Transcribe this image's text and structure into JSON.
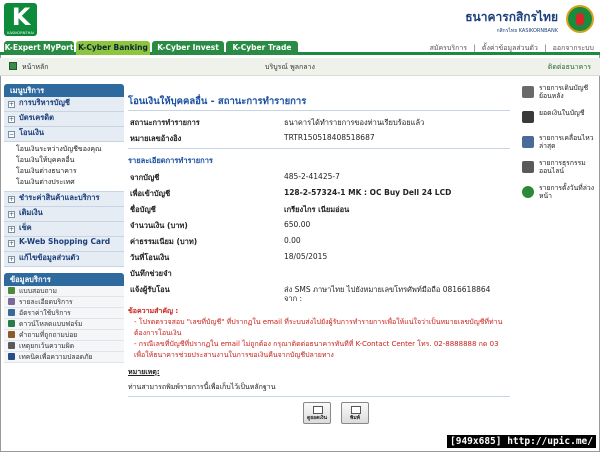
{
  "header": {
    "logo_letter": "K",
    "logo_text": "KASIKORNTHAI",
    "bank_name_th": "ธนาคารกสิกรไทย",
    "bank_name_en": "กสิกรไทย KASIKORNBANK"
  },
  "tabs": [
    {
      "label": "K-Expert MyPort",
      "active": false
    },
    {
      "label": "K-Cyber Banking",
      "active": true
    },
    {
      "label": "K-Cyber Invest",
      "active": false
    },
    {
      "label": "K-Cyber Trade",
      "active": false
    }
  ],
  "toplinks": [
    "สมัครบริการ",
    "|",
    "ตั้งค่าข้อมูลส่วนตัว",
    "|",
    "ออกจากระบบ"
  ],
  "subheader": {
    "home": "หน้าหลัก",
    "user": "บริบูรณ์ พูลกลาง",
    "contact": "ติดต่อธนาคาร"
  },
  "menu": {
    "title": "เมนูบริการ",
    "items": [
      {
        "label": "การบริหารบัญชี",
        "sign": "+"
      },
      {
        "label": "บัตรเครดิต",
        "sign": "+"
      },
      {
        "label": "โอนเงิน",
        "sign": "−"
      }
    ],
    "transfer_sub": [
      "โอนเงินระหว่างบัญชีของคุณ",
      "โอนเงินให้บุคคลอื่น",
      "โอนเงินต่างธนาคาร",
      "โอนเงินต่างประเทศ"
    ],
    "items2": [
      {
        "label": "ชำระค่าสินค้าและบริการ",
        "sign": "+"
      },
      {
        "label": "เติมเงิน",
        "sign": "+"
      },
      {
        "label": "เช็ค",
        "sign": "+"
      },
      {
        "label": "K-Web Shopping Card",
        "sign": "+"
      },
      {
        "label": "แก้ไขข้อมูลส่วนตัว",
        "sign": "+"
      }
    ]
  },
  "services": {
    "title": "ข้อมูลบริการ",
    "items": [
      {
        "label": "แบบสอบถาม",
        "color": "#4a8a3a"
      },
      {
        "label": "รายละเอียดบริการ",
        "color": "#7a6a9a"
      },
      {
        "label": "อัตราค่าใช้บริการ",
        "color": "#3a6a9a"
      },
      {
        "label": "ดาวน์โหลดแบบฟอร์ม",
        "color": "#2a7a4a"
      },
      {
        "label": "คำถามที่ถูกถามบ่อย",
        "color": "#8a5a2a"
      },
      {
        "label": "เหตุยกเว้นความผิด",
        "color": "#5a5a5a"
      },
      {
        "label": "เทคนิคเพื่อความปลอดภัย",
        "color": "#2a4a8a"
      }
    ]
  },
  "main": {
    "title": "โอนเงินให้บุคคลอื่น - สถานะการทำรายการ",
    "status_label": "สถานะการทำรายการ",
    "status_value": "ธนาคารได้ทำรายการของท่านเรียบร้อยแล้ว",
    "ref_label": "หมายเลขอ้างอิง",
    "ref_value": "TRTR150518408518687",
    "section": "รายละเอียดการทำรายการ",
    "rows": [
      {
        "label": "จากบัญชี",
        "value": "485-2-41425-7",
        "bold": false
      },
      {
        "label": "เพื่อเข้าบัญชี",
        "value": "128-2-57324-1 MK : OC Buy Dell 24 LCD",
        "bold": true
      },
      {
        "label": "ชื่อบัญชี",
        "value": "เกรียงไกร เนียมอ่อน",
        "bold": true
      },
      {
        "label": "จำนวนเงิน (บาท)",
        "value": "650.00",
        "bold": false
      },
      {
        "label": "ค่าธรรมเนียม (บาท)",
        "value": "0.00",
        "bold": false
      },
      {
        "label": "วันที่โอนเงิน",
        "value": "18/05/2015",
        "bold": false
      },
      {
        "label": "บันทึกช่วยจำ",
        "value": "",
        "bold": false
      },
      {
        "label": "แจ้งผู้รับโอน",
        "value": "ส่ง SMS ภาษาไทย ไปยังหมายเลขโทรศัพท์มือถือ 0816618864",
        "bold": false
      }
    ],
    "notify_from": "จาก :",
    "note_title": "ข้อความสำคัญ :",
    "note1": "- โปรดตรวจสอบ \"เลขที่บัญชี\" ที่ปรากฏใน email ที่ระบบส่งไปยังผู้รับการทำรายการเพื่อให้แน่ใจว่าเป็นหมายเลขบัญชีที่ท่านต้องการโอนเงิน",
    "note2": "- กรณีเลขที่บัญชีที่ปรากฏใน email ไม่ถูกต้อง กรุณาติดต่อธนาคารทันทีที่ K-Contact Center โทร. 02-8888888 กด 03 เพื่อให้ธนาคารช่วยประสานงานในการขอเงินคืนจากบัญชีปลายทาง",
    "remark_title": "หมายเหตุ:",
    "remark": "ท่านสามารถพิมพ์รายการนี้เพื่อเก็บไว้เป็นหลักฐาน",
    "btn_check": "ดูยอดเงิน",
    "btn_print": "พิมพ์"
  },
  "right": [
    {
      "label": "รายการเดินบัญชีย้อนหลัง",
      "color": "#6a6a6a"
    },
    {
      "label": "ยอดเงินในบัญชี",
      "color": "#3a3a3a"
    },
    {
      "label": "รายการเคลื่อนไหวล่าสุด",
      "color": "#4a6a9a"
    },
    {
      "label": "รายการธุรกรรมออนไลน์",
      "color": "#5a5a5a"
    },
    {
      "label": "รายการตั้งวันที่ล่วงหน้า",
      "color": "#2a8a3a"
    }
  ],
  "watermark": "[949x685] http://upic.me/"
}
